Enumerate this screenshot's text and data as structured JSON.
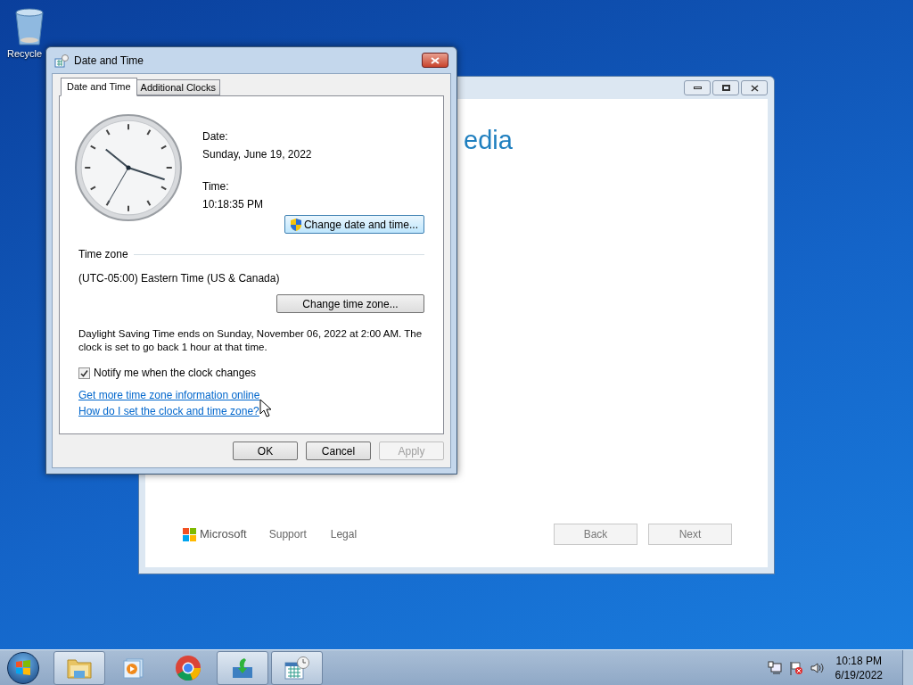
{
  "desktop_icons": [
    {
      "label": "Recycle"
    }
  ],
  "background_window": {
    "heading": "edia",
    "logo_text": "Microsoft",
    "footer_links": [
      "Support",
      "Legal"
    ],
    "buttons": [
      "Back",
      "Next"
    ]
  },
  "dialog": {
    "title": "Date and Time",
    "tabs": [
      {
        "label": "Date and Time",
        "selected": true
      },
      {
        "label": "Additional Clocks",
        "selected": false
      }
    ],
    "date_label": "Date:",
    "date_value": "Sunday, June 19, 2022",
    "time_label": "Time:",
    "time_value": "10:18:35 PM",
    "change_date_button": "Change date and time...",
    "timezone_heading": "Time zone",
    "timezone_value": "(UTC-05:00) Eastern Time (US & Canada)",
    "change_timezone_button": "Change time zone...",
    "dst_text": "Daylight Saving Time ends on Sunday, November 06, 2022 at 2:00 AM. The clock is set to go back 1 hour at that time.",
    "notify": {
      "label": "Notify me when the clock changes",
      "checked": true
    },
    "links": [
      "Get more time zone information online",
      "How do I set the clock and time zone?"
    ],
    "buttons": [
      {
        "label": "OK",
        "disabled": false
      },
      {
        "label": "Cancel",
        "disabled": false
      },
      {
        "label": "Apply",
        "disabled": true
      }
    ]
  },
  "taskbar": {
    "apps": [
      {
        "kind": "folder",
        "running": true
      },
      {
        "kind": "media",
        "running": false
      },
      {
        "kind": "browser",
        "running": false
      },
      {
        "kind": "installer",
        "running": true
      },
      {
        "kind": "calendar",
        "running": true
      }
    ],
    "clock": {
      "time": "10:18 PM",
      "date": "6/19/2022"
    }
  }
}
